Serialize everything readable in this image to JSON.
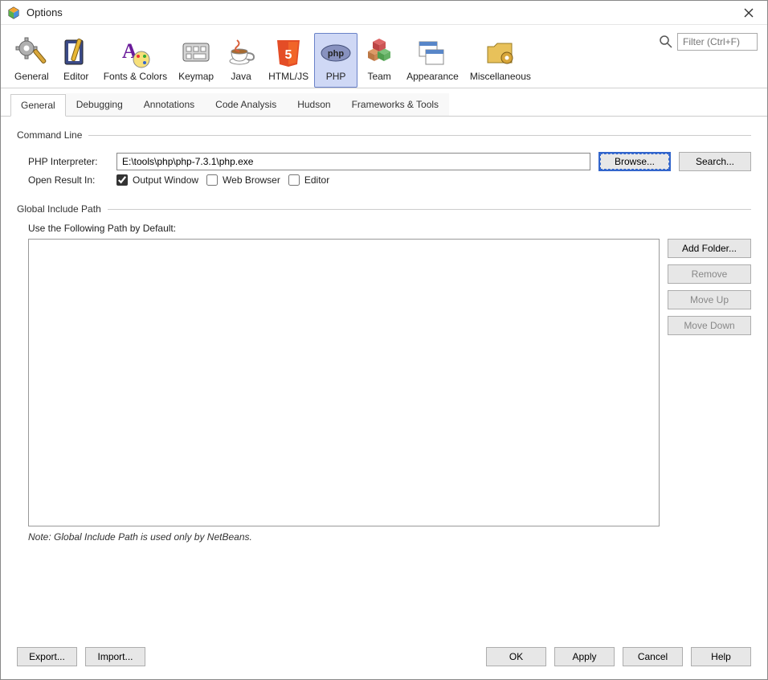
{
  "window": {
    "title": "Options"
  },
  "search": {
    "placeholder": "Filter (Ctrl+F)"
  },
  "toolbar": {
    "items": [
      {
        "label": "General"
      },
      {
        "label": "Editor"
      },
      {
        "label": "Fonts & Colors"
      },
      {
        "label": "Keymap"
      },
      {
        "label": "Java"
      },
      {
        "label": "HTML/JS"
      },
      {
        "label": "PHP"
      },
      {
        "label": "Team"
      },
      {
        "label": "Appearance"
      },
      {
        "label": "Miscellaneous"
      }
    ],
    "selected_index": 6
  },
  "tabs": {
    "items": [
      {
        "label": "General"
      },
      {
        "label": "Debugging"
      },
      {
        "label": "Annotations"
      },
      {
        "label": "Code Analysis"
      },
      {
        "label": "Hudson"
      },
      {
        "label": "Frameworks & Tools"
      }
    ],
    "selected_index": 0
  },
  "command_line": {
    "legend": "Command Line",
    "interpreter_label": "PHP Interpreter:",
    "interpreter_value": "E:\\tools\\php\\php-7.3.1\\php.exe",
    "browse": "Browse...",
    "search": "Search...",
    "open_result_label": "Open Result In:",
    "output_window": "Output Window",
    "web_browser": "Web Browser",
    "editor": "Editor",
    "output_window_checked": true,
    "web_browser_checked": false,
    "editor_checked": false
  },
  "include_path": {
    "legend": "Global Include Path",
    "use_label": "Use the Following Path by Default:",
    "add_folder": "Add Folder...",
    "remove": "Remove",
    "move_up": "Move Up",
    "move_down": "Move Down",
    "note": "Note: Global Include Path is used only by NetBeans."
  },
  "footer": {
    "export": "Export...",
    "import": "Import...",
    "ok": "OK",
    "apply": "Apply",
    "cancel": "Cancel",
    "help": "Help"
  }
}
